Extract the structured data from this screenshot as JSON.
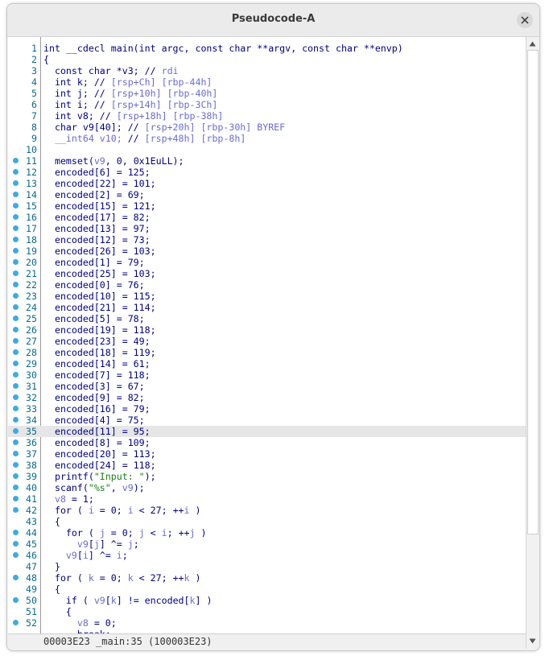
{
  "window": {
    "title": "Pseudocode-A"
  },
  "status": {
    "text": "00003E23 _main:35 (100003E23)"
  },
  "colors": {
    "breakpoint": "#3fa9e6",
    "line_number": "#0b6b8a",
    "keyword": "#000080",
    "variable": "#6b6bd0",
    "string": "#1a7d1a",
    "highlight": "#e6e6e6"
  },
  "highlighted_line": 35,
  "lines": [
    {
      "n": "1",
      "bp": false,
      "tokens": [
        [
          "kw",
          "int __cdecl main(int argc, const char **argv, const char **envp)"
        ]
      ]
    },
    {
      "n": "2",
      "bp": false,
      "tokens": [
        [
          "kw",
          "{"
        ]
      ]
    },
    {
      "n": "3",
      "bp": false,
      "tokens": [
        [
          "kw",
          "  const char *v3; // "
        ],
        [
          "cmt",
          "rdi"
        ]
      ]
    },
    {
      "n": "4",
      "bp": false,
      "tokens": [
        [
          "kw",
          "  int k; // "
        ],
        [
          "cmt",
          "[rsp+Ch] [rbp-44h]"
        ]
      ]
    },
    {
      "n": "5",
      "bp": false,
      "tokens": [
        [
          "kw",
          "  int j; // "
        ],
        [
          "cmt",
          "[rsp+10h] [rbp-40h]"
        ]
      ]
    },
    {
      "n": "6",
      "bp": false,
      "tokens": [
        [
          "kw",
          "  int i; // "
        ],
        [
          "cmt",
          "[rsp+14h] [rbp-3Ch]"
        ]
      ]
    },
    {
      "n": "7",
      "bp": false,
      "tokens": [
        [
          "kw",
          "  int v8; // "
        ],
        [
          "cmt",
          "[rsp+18h] [rbp-38h]"
        ]
      ]
    },
    {
      "n": "8",
      "bp": false,
      "tokens": [
        [
          "kw",
          "  char v9[40]; // "
        ],
        [
          "cmt",
          "[rsp+20h] [rbp-30h] BYREF"
        ]
      ]
    },
    {
      "n": "9",
      "bp": false,
      "tokens": [
        [
          "var",
          "  __int64 v10; "
        ],
        [
          "kw",
          "// "
        ],
        [
          "cmt",
          "[rsp+48h] [rbp-8h]"
        ]
      ]
    },
    {
      "n": "10",
      "bp": false,
      "tokens": [
        [
          "kw",
          ""
        ]
      ]
    },
    {
      "n": "11",
      "bp": true,
      "tokens": [
        [
          "kw",
          "  memset("
        ],
        [
          "var",
          "v9"
        ],
        [
          "kw",
          ", 0, 0x1EuLL);"
        ]
      ]
    },
    {
      "n": "12",
      "bp": true,
      "tokens": [
        [
          "kw",
          "  encoded[6] = 125;"
        ]
      ]
    },
    {
      "n": "13",
      "bp": true,
      "tokens": [
        [
          "kw",
          "  encoded[22] = 101;"
        ]
      ]
    },
    {
      "n": "14",
      "bp": true,
      "tokens": [
        [
          "kw",
          "  encoded[2] = 69;"
        ]
      ]
    },
    {
      "n": "15",
      "bp": true,
      "tokens": [
        [
          "kw",
          "  encoded[15] = 121;"
        ]
      ]
    },
    {
      "n": "16",
      "bp": true,
      "tokens": [
        [
          "kw",
          "  encoded[17] = 82;"
        ]
      ]
    },
    {
      "n": "17",
      "bp": true,
      "tokens": [
        [
          "kw",
          "  encoded[13] = 97;"
        ]
      ]
    },
    {
      "n": "18",
      "bp": true,
      "tokens": [
        [
          "kw",
          "  encoded[12] = 73;"
        ]
      ]
    },
    {
      "n": "19",
      "bp": true,
      "tokens": [
        [
          "kw",
          "  encoded[26] = 103;"
        ]
      ]
    },
    {
      "n": "20",
      "bp": true,
      "tokens": [
        [
          "kw",
          "  encoded[1] = 79;"
        ]
      ]
    },
    {
      "n": "21",
      "bp": true,
      "tokens": [
        [
          "kw",
          "  encoded[25] = 103;"
        ]
      ]
    },
    {
      "n": "22",
      "bp": true,
      "tokens": [
        [
          "kw",
          "  encoded[0] = 76;"
        ]
      ]
    },
    {
      "n": "23",
      "bp": true,
      "tokens": [
        [
          "kw",
          "  encoded[10] = 115;"
        ]
      ]
    },
    {
      "n": "24",
      "bp": true,
      "tokens": [
        [
          "kw",
          "  encoded[21] = 114;"
        ]
      ]
    },
    {
      "n": "25",
      "bp": true,
      "tokens": [
        [
          "kw",
          "  encoded[5] = 78;"
        ]
      ]
    },
    {
      "n": "26",
      "bp": true,
      "tokens": [
        [
          "kw",
          "  encoded[19] = 118;"
        ]
      ]
    },
    {
      "n": "27",
      "bp": true,
      "tokens": [
        [
          "kw",
          "  encoded[23] = 49;"
        ]
      ]
    },
    {
      "n": "28",
      "bp": true,
      "tokens": [
        [
          "kw",
          "  encoded[18] = 119;"
        ]
      ]
    },
    {
      "n": "29",
      "bp": true,
      "tokens": [
        [
          "kw",
          "  encoded[14] = 61;"
        ]
      ]
    },
    {
      "n": "30",
      "bp": true,
      "tokens": [
        [
          "kw",
          "  encoded[7] = 118;"
        ]
      ]
    },
    {
      "n": "31",
      "bp": true,
      "tokens": [
        [
          "kw",
          "  encoded[3] = 67;"
        ]
      ]
    },
    {
      "n": "32",
      "bp": true,
      "tokens": [
        [
          "kw",
          "  encoded[9] = 82;"
        ]
      ]
    },
    {
      "n": "33",
      "bp": true,
      "tokens": [
        [
          "kw",
          "  encoded[16] = 79;"
        ]
      ]
    },
    {
      "n": "34",
      "bp": true,
      "tokens": [
        [
          "kw",
          "  encoded[4] = 75;"
        ]
      ]
    },
    {
      "n": "35",
      "bp": true,
      "tokens": [
        [
          "kw",
          "  encoded[11] = 95;"
        ]
      ]
    },
    {
      "n": "36",
      "bp": true,
      "tokens": [
        [
          "kw",
          "  encoded[8] = 109;"
        ]
      ]
    },
    {
      "n": "37",
      "bp": true,
      "tokens": [
        [
          "kw",
          "  encoded[20] = 113;"
        ]
      ]
    },
    {
      "n": "38",
      "bp": true,
      "tokens": [
        [
          "kw",
          "  encoded[24] = 118;"
        ]
      ]
    },
    {
      "n": "39",
      "bp": true,
      "tokens": [
        [
          "kw",
          "  printf("
        ],
        [
          "str",
          "\"Input: \""
        ],
        [
          "kw",
          ");"
        ]
      ]
    },
    {
      "n": "40",
      "bp": true,
      "tokens": [
        [
          "kw",
          "  scanf("
        ],
        [
          "str",
          "\"%s\""
        ],
        [
          "kw",
          ", "
        ],
        [
          "var",
          "v9"
        ],
        [
          "kw",
          ");"
        ]
      ]
    },
    {
      "n": "41",
      "bp": true,
      "tokens": [
        [
          "var",
          "  v8"
        ],
        [
          "kw",
          " = 1;"
        ]
      ]
    },
    {
      "n": "42",
      "bp": true,
      "tokens": [
        [
          "kw",
          "  for ( "
        ],
        [
          "var",
          "i"
        ],
        [
          "kw",
          " = 0; "
        ],
        [
          "var",
          "i"
        ],
        [
          "kw",
          " < 27; ++"
        ],
        [
          "var",
          "i"
        ],
        [
          "kw",
          " )"
        ]
      ]
    },
    {
      "n": "43",
      "bp": false,
      "tokens": [
        [
          "kw",
          "  {"
        ]
      ]
    },
    {
      "n": "44",
      "bp": true,
      "tokens": [
        [
          "kw",
          "    for ( "
        ],
        [
          "var",
          "j"
        ],
        [
          "kw",
          " = 0; "
        ],
        [
          "var",
          "j"
        ],
        [
          "kw",
          " < "
        ],
        [
          "var",
          "i"
        ],
        [
          "kw",
          "; ++"
        ],
        [
          "var",
          "j"
        ],
        [
          "kw",
          " )"
        ]
      ]
    },
    {
      "n": "45",
      "bp": true,
      "tokens": [
        [
          "var",
          "      v9"
        ],
        [
          "kw",
          "["
        ],
        [
          "var",
          "j"
        ],
        [
          "kw",
          "] ^= "
        ],
        [
          "var",
          "j"
        ],
        [
          "kw",
          ";"
        ]
      ]
    },
    {
      "n": "46",
      "bp": true,
      "tokens": [
        [
          "var",
          "    v9"
        ],
        [
          "kw",
          "["
        ],
        [
          "var",
          "i"
        ],
        [
          "kw",
          "] ^= "
        ],
        [
          "var",
          "i"
        ],
        [
          "kw",
          ";"
        ]
      ]
    },
    {
      "n": "47",
      "bp": false,
      "tokens": [
        [
          "kw",
          "  }"
        ]
      ]
    },
    {
      "n": "48",
      "bp": true,
      "tokens": [
        [
          "kw",
          "  for ( "
        ],
        [
          "var",
          "k"
        ],
        [
          "kw",
          " = 0; "
        ],
        [
          "var",
          "k"
        ],
        [
          "kw",
          " < 27; ++"
        ],
        [
          "var",
          "k"
        ],
        [
          "kw",
          " )"
        ]
      ]
    },
    {
      "n": "49",
      "bp": false,
      "tokens": [
        [
          "kw",
          "  {"
        ]
      ]
    },
    {
      "n": "50",
      "bp": true,
      "tokens": [
        [
          "kw",
          "    if ( "
        ],
        [
          "var",
          "v9"
        ],
        [
          "kw",
          "["
        ],
        [
          "var",
          "k"
        ],
        [
          "kw",
          "] != encoded["
        ],
        [
          "var",
          "k"
        ],
        [
          "kw",
          "] )"
        ]
      ]
    },
    {
      "n": "51",
      "bp": false,
      "tokens": [
        [
          "kw",
          "    {"
        ]
      ]
    },
    {
      "n": "52",
      "bp": true,
      "tokens": [
        [
          "var",
          "      v8"
        ],
        [
          "kw",
          " = 0;"
        ]
      ]
    },
    {
      "n": "",
      "bp": false,
      "tokens": [
        [
          "kw",
          "      break;"
        ]
      ]
    }
  ]
}
